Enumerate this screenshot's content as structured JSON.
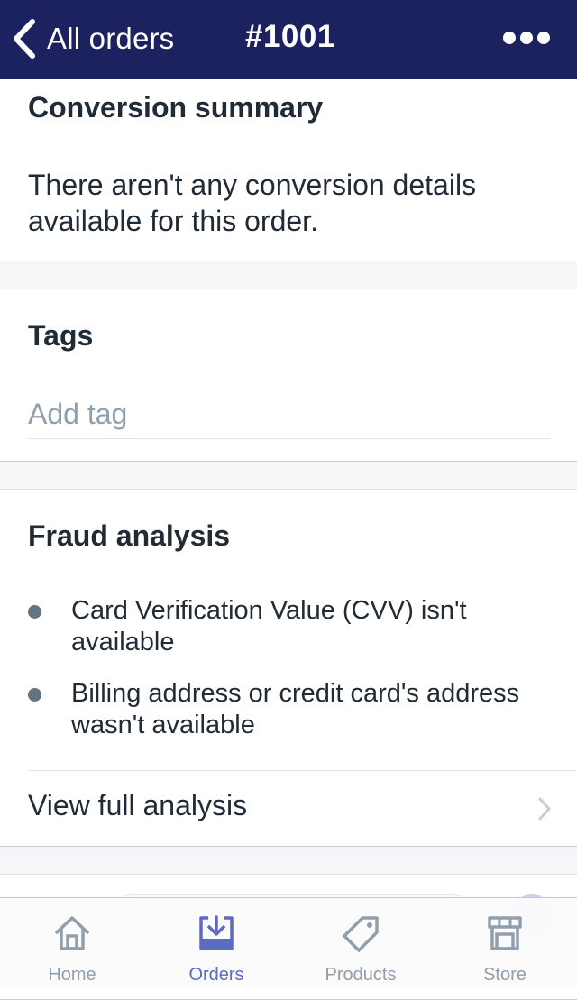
{
  "header": {
    "back_label": "All orders",
    "title": "#1001"
  },
  "conversion": {
    "heading": "Conversion summary",
    "message": "There aren't any conversion details available for this order."
  },
  "tags": {
    "heading": "Tags",
    "placeholder": "Add tag",
    "value": ""
  },
  "fraud": {
    "heading": "Fraud analysis",
    "items": [
      {
        "text": "Card Verification Value (CVV) isn't available"
      },
      {
        "text": "Billing address or credit card's address wasn't available"
      }
    ],
    "view_full_label": "View full analysis"
  },
  "tabbar": {
    "tabs": [
      {
        "label": "Home",
        "icon": "home-icon"
      },
      {
        "label": "Orders",
        "icon": "orders-icon",
        "active": true
      },
      {
        "label": "Products",
        "icon": "tag-icon"
      },
      {
        "label": "Store",
        "icon": "store-icon"
      }
    ]
  },
  "colors": {
    "nav_bar": "#1c2260",
    "accent": "#5c6ac4",
    "inactive": "#919eab",
    "text": "#212b36",
    "bullet": "#637381",
    "background": "#f4f6f8"
  }
}
